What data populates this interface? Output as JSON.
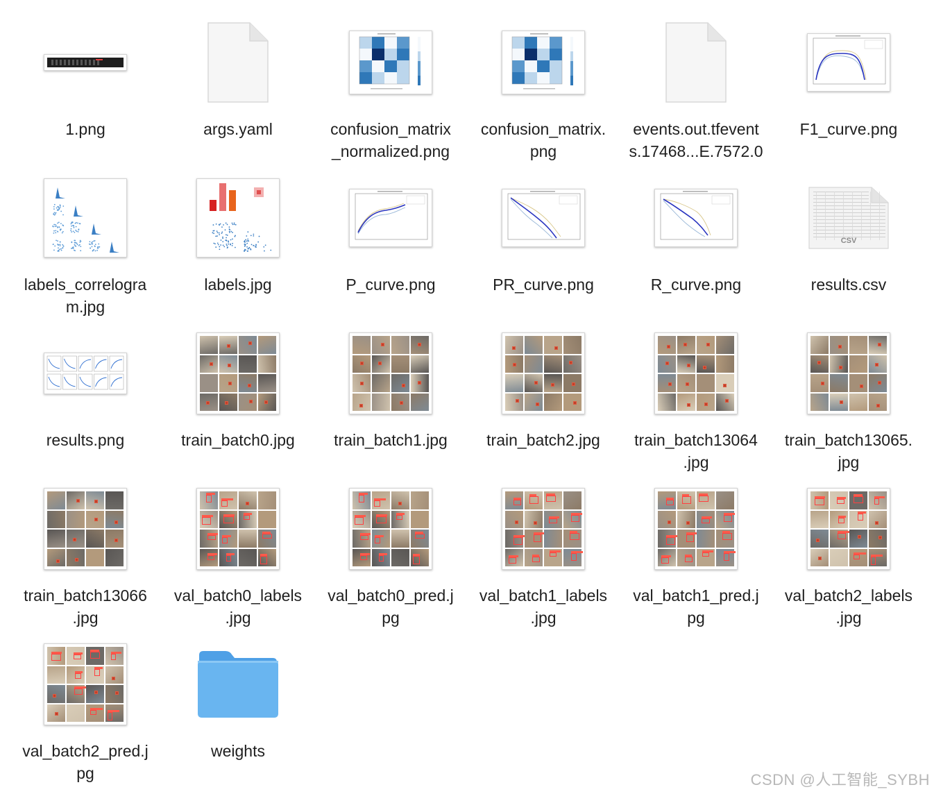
{
  "files": [
    {
      "name": "1.png",
      "thumb": "strip",
      "label": "1.png"
    },
    {
      "name": "args.yaml",
      "thumb": "doc",
      "label": "args.yaml"
    },
    {
      "name": "confusion_matrix_normalized.png",
      "thumb": "confusion",
      "label": "confusion_matrix\n_normalized.png"
    },
    {
      "name": "confusion_matrix.png",
      "thumb": "confusion",
      "label": "confusion_matrix.\npng"
    },
    {
      "name": "events.out.tfevents.17468...E.7572.0",
      "thumb": "doc",
      "label": "events.out.tfevent\ns.17468...E.7572.0"
    },
    {
      "name": "F1_curve.png",
      "thumb": "curve-f1",
      "label": "F1_curve.png"
    },
    {
      "name": "labels_correlogram.jpg",
      "thumb": "correlogram",
      "label": "labels_correlogra\nm.jpg"
    },
    {
      "name": "labels.jpg",
      "thumb": "labels",
      "label": "labels.jpg"
    },
    {
      "name": "P_curve.png",
      "thumb": "curve-p",
      "label": "P_curve.png"
    },
    {
      "name": "PR_curve.png",
      "thumb": "curve-pr",
      "label": "PR_curve.png"
    },
    {
      "name": "R_curve.png",
      "thumb": "curve-r",
      "label": "R_curve.png"
    },
    {
      "name": "results.csv",
      "thumb": "csv",
      "label": "results.csv",
      "badge": "CSV"
    },
    {
      "name": "results.png",
      "thumb": "results",
      "label": "results.png"
    },
    {
      "name": "train_batch0.jpg",
      "thumb": "mosaic-a",
      "label": "train_batch0.jpg"
    },
    {
      "name": "train_batch1.jpg",
      "thumb": "mosaic-b",
      "label": "train_batch1.jpg"
    },
    {
      "name": "train_batch2.jpg",
      "thumb": "mosaic-c",
      "label": "train_batch2.jpg"
    },
    {
      "name": "train_batch13064.jpg",
      "thumb": "mosaic-d",
      "label": "train_batch13064\n.jpg"
    },
    {
      "name": "train_batch13065.jpg",
      "thumb": "mosaic-e",
      "label": "train_batch13065.\njpg"
    },
    {
      "name": "train_batch13066.jpg",
      "thumb": "mosaic-f",
      "label": "train_batch13066\n.jpg"
    },
    {
      "name": "val_batch0_labels.jpg",
      "thumb": "mosaic-val",
      "label": "val_batch0_labels\n.jpg"
    },
    {
      "name": "val_batch0_pred.jpg",
      "thumb": "mosaic-val",
      "label": "val_batch0_pred.j\npg"
    },
    {
      "name": "val_batch1_labels.jpg",
      "thumb": "mosaic-val2",
      "label": "val_batch1_labels\n.jpg"
    },
    {
      "name": "val_batch1_pred.jpg",
      "thumb": "mosaic-val2",
      "label": "val_batch1_pred.j\npg"
    },
    {
      "name": "val_batch2_labels.jpg",
      "thumb": "mosaic-val3",
      "label": "val_batch2_labels\n.jpg"
    },
    {
      "name": "val_batch2_pred.jpg",
      "thumb": "mosaic-val3",
      "label": "val_batch2_pred.j\npg"
    },
    {
      "name": "weights",
      "thumb": "folder",
      "label": "weights"
    }
  ],
  "watermark": "CSDN @人工智能_SYBH",
  "colors": {
    "folder_front": "#69b5f0",
    "folder_back": "#4fa0e6",
    "confusion_dark": "#0b2f6b",
    "confusion_mid": "#2f78b8",
    "confusion_light": "#bcd6ec"
  }
}
